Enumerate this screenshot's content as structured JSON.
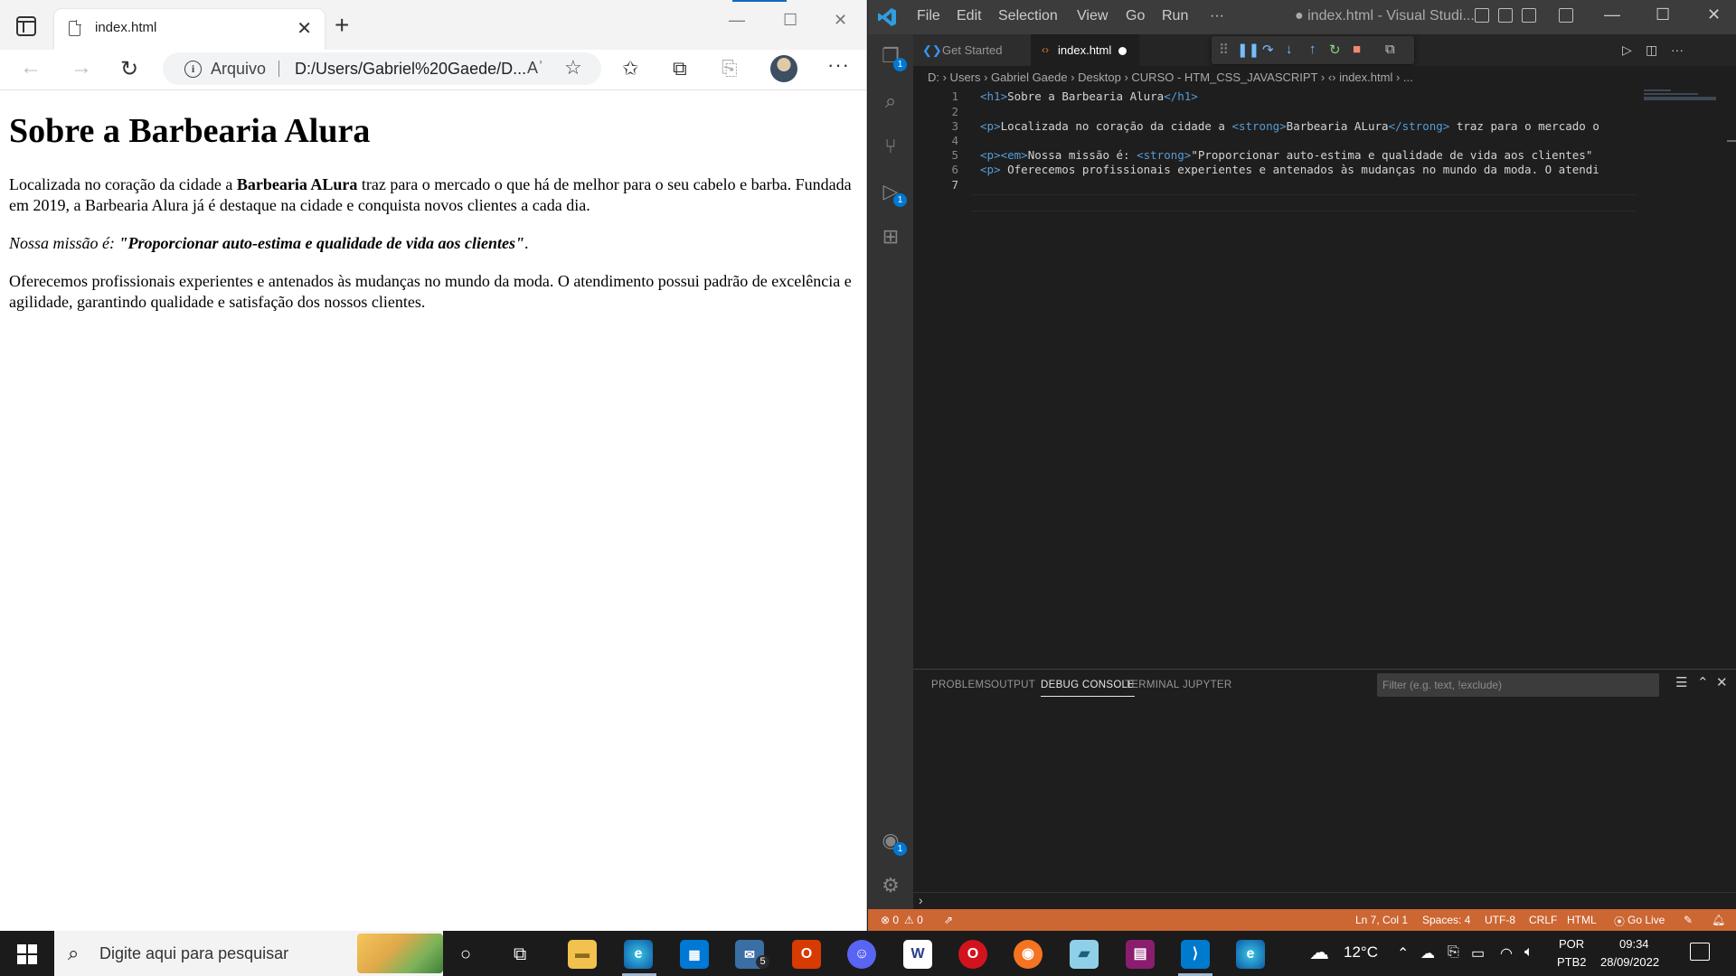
{
  "browser": {
    "tab_title": "index.html",
    "tab_close": "✕",
    "new_tab": "+",
    "address_scheme_label": "Arquivo",
    "address_url": "D:/Users/Gabriel%20Gaede/D...",
    "read_aloud": "Aʾ",
    "page": {
      "heading": "Sobre a Barbearia Alura",
      "p1_before": "Localizada no coração da cidade a ",
      "p1_strong": "Barbearia ALura",
      "p1_after": " traz para o mercado o que há de melhor para o seu cabelo e barba. Fundada em 2019, a Barbearia Alura já é destaque na cidade e conquista novos clientes a cada dia.",
      "p2_em": "Nossa missão é: ",
      "p2_strong": "\"Proporcionar auto-estima e qualidade de vida aos clientes\"",
      "p2_after": ".",
      "p3": "Oferecemos profissionais experientes e antenados às mudanças no mundo da moda. O atendimento possui padrão de excelência e agilidade, garantindo qualidade e satisfação dos nossos clientes."
    }
  },
  "vscode": {
    "menu": [
      "File",
      "Edit",
      "Selection",
      "View",
      "Go",
      "Run",
      "···"
    ],
    "window_title": "● index.html - Visual Studi...",
    "tabs": [
      {
        "label": "Get Started"
      },
      {
        "label": "index.html"
      }
    ],
    "breadcrumb": "D:  ›  Users  ›  Gabriel Gaede  ›  Desktop  ›  CURSO - HTM_CSS_JAVASCRIPT  ›  ‹›  index.html  ›  ...",
    "line_numbers": [
      "1",
      "2",
      "3",
      "4",
      "5",
      "6",
      "7"
    ],
    "code": {
      "l1_open": "<h1>",
      "l1_text": "Sobre a Barbearia Alura",
      "l1_close": "</h1>",
      "l3_open": "<p>",
      "l3_text": "Localizada no coração da cidade a ",
      "l3_strong_open": "<strong>",
      "l3_strong": "Barbearia ALura",
      "l3_strong_close": "</strong>",
      "l3_after": " traz para o mercado o",
      "l5_open": "<p><em>",
      "l5_text": "Nossa missão é: ",
      "l5_strong_open": "<strong>",
      "l5_strong": "\"Proporcionar auto-estima e qualidade de vida aos clientes\"",
      "l6_open": "<p>",
      "l6_text": " Oferecemos profissionais experientes e antenados às mudanças no mundo da moda. O atendi"
    },
    "panel_tabs": [
      "PROBLEMS",
      "OUTPUT",
      "DEBUG CONSOLE",
      "TERMINAL",
      "JUPYTER"
    ],
    "filter_placeholder": "Filter (e.g. text, !exclude)",
    "prompt": "›",
    "status": {
      "errors": "⊗ 0",
      "warnings": "⚠ 0",
      "position": "Ln 7, Col 1",
      "spaces": "Spaces: 4",
      "encoding": "UTF-8",
      "eol": "CRLF",
      "language": "HTML",
      "go_live": "Go Live"
    },
    "badges": {
      "explorer": "1",
      "run": "1",
      "accounts": "1"
    }
  },
  "taskbar": {
    "search_placeholder": "Digite aqui para pesquisar",
    "mail_badge": "5",
    "temperature": "12°C",
    "lang_top": "POR",
    "lang_bottom": "PTB2",
    "time": "09:34",
    "date": "28/09/2022"
  },
  "colors": {
    "vscode_status": "#cc6633",
    "vscode_accent": "#0078d4",
    "taskbar": "#1b1b1b"
  }
}
